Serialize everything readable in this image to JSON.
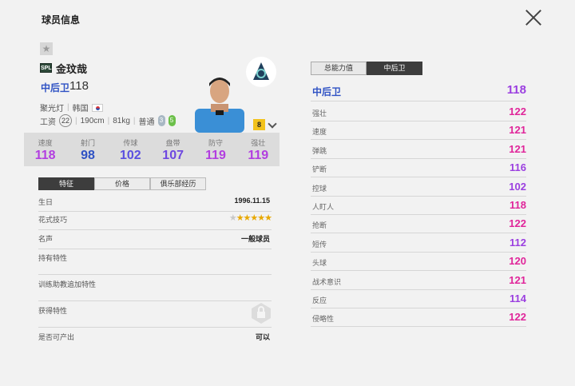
{
  "title": "球员信息",
  "player": {
    "season_badge": "SPL",
    "name": "金玟哉",
    "position": "中后卫",
    "ovr": "118",
    "program": "聚光灯",
    "nation": "韩国",
    "wage_label": "工资",
    "wage": "22",
    "height": "190cm",
    "weight": "81kg",
    "body": "普通",
    "left_foot": "3",
    "right_foot": "5",
    "grade": "8"
  },
  "stats": [
    {
      "label": "速度",
      "value": "118",
      "color": "#b23ee0"
    },
    {
      "label": "射门",
      "value": "98",
      "color": "#2f52c4"
    },
    {
      "label": "传球",
      "value": "102",
      "color": "#5a4fe0"
    },
    {
      "label": "盘带",
      "value": "107",
      "color": "#6e48e0"
    },
    {
      "label": "防守",
      "value": "119",
      "color": "#b23ee0"
    },
    {
      "label": "强壮",
      "value": "119",
      "color": "#b23ee0"
    }
  ],
  "tabs": [
    "特征",
    "价格",
    "俱乐部经历"
  ],
  "info": {
    "birthday_label": "生日",
    "birthday": "1996.11.15",
    "skill_label": "花式技巧",
    "stars": "★",
    "stars_filled": "★★★★★",
    "rating": 5,
    "fame_label": "名声",
    "fame": "一般球员",
    "traits_label": "持有特性",
    "coach_label": "训练助教追加特性",
    "acquired_label": "获得特性",
    "tradeable_label": "是否可产出",
    "tradeable": "可以"
  },
  "right_tabs": [
    "总能力值",
    "中后卫"
  ],
  "position_rating": {
    "label": "中后卫",
    "value": "118"
  },
  "attributes": [
    {
      "label": "强壮",
      "value": "122"
    },
    {
      "label": "速度",
      "value": "121"
    },
    {
      "label": "弹跳",
      "value": "121"
    },
    {
      "label": "铲断",
      "value": "116"
    },
    {
      "label": "控球",
      "value": "102"
    },
    {
      "label": "人盯人",
      "value": "118"
    },
    {
      "label": "抢断",
      "value": "122"
    },
    {
      "label": "短传",
      "value": "112"
    },
    {
      "label": "头球",
      "value": "120"
    },
    {
      "label": "战术意识",
      "value": "121"
    },
    {
      "label": "反应",
      "value": "114"
    },
    {
      "label": "侵略性",
      "value": "122"
    }
  ],
  "colors": {
    "pink": "#e0259a",
    "purple": "#9b3fe0",
    "blue": "#2f52c4"
  }
}
